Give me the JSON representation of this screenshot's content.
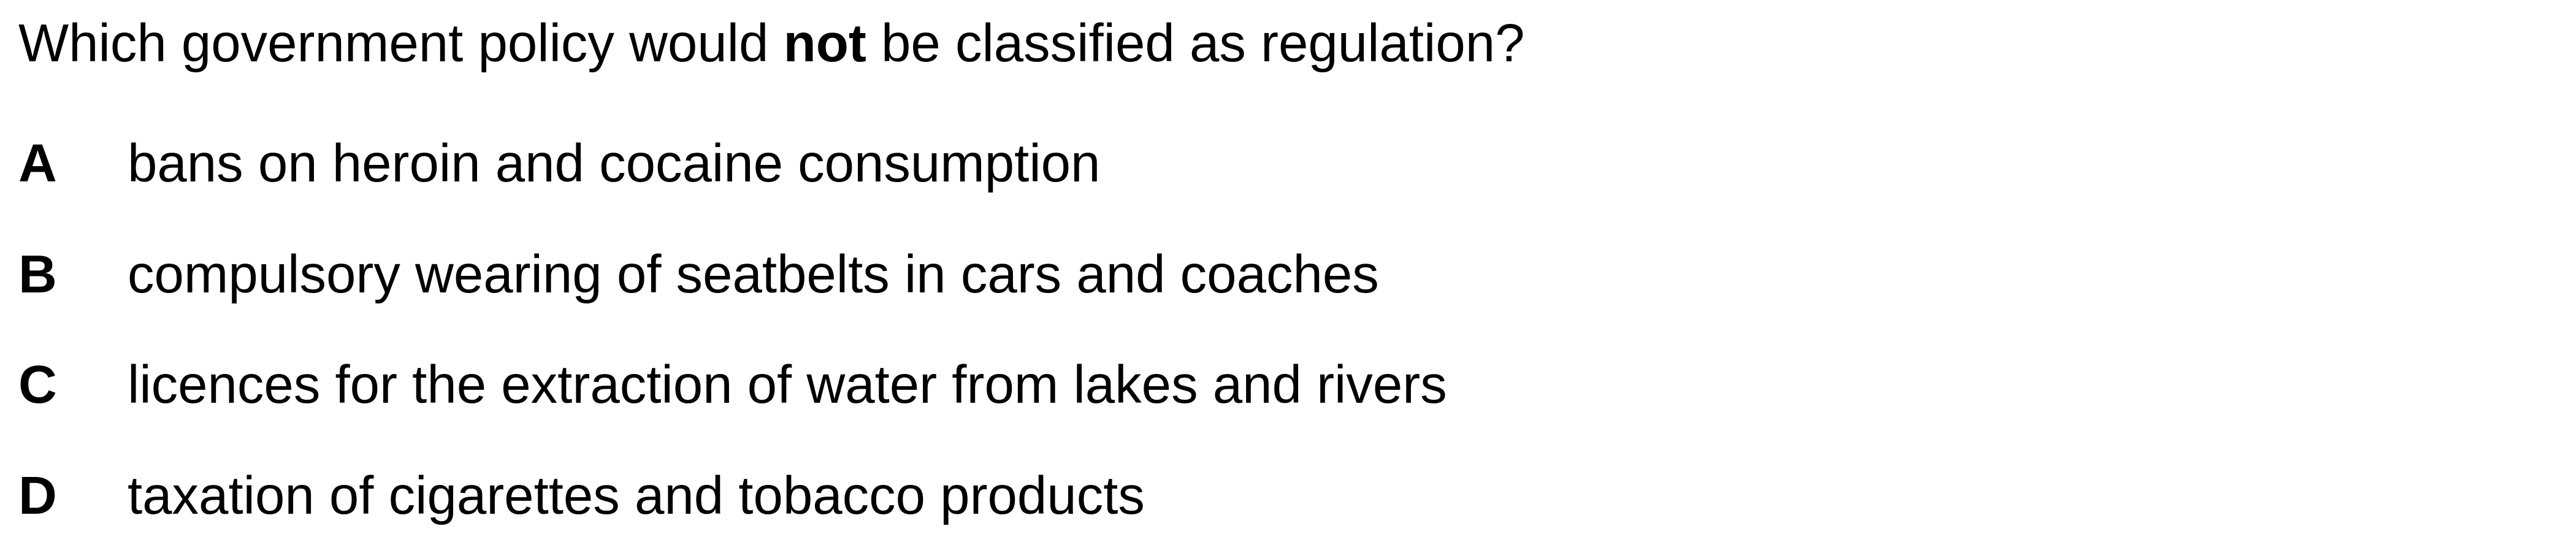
{
  "question": {
    "prefix": "Which government policy would ",
    "emphasis": "not",
    "suffix": " be classified as regulation?"
  },
  "options": [
    {
      "letter": "A",
      "text": "bans on heroin and cocaine consumption"
    },
    {
      "letter": "B",
      "text": "compulsory wearing of seatbelts in cars and coaches"
    },
    {
      "letter": "C",
      "text": "licences for the extraction of water from lakes and rivers"
    },
    {
      "letter": "D",
      "text": "taxation of cigarettes and tobacco products"
    }
  ]
}
